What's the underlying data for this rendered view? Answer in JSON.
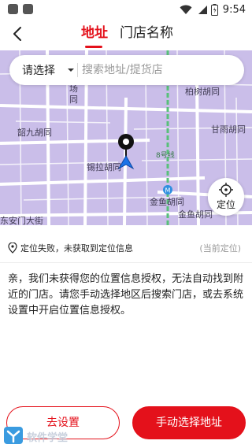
{
  "status_bar": {
    "time": "9:54",
    "battery_icon": "battery-icon",
    "wifi_icon": "wifi-icon"
  },
  "header": {
    "back_icon": "back-arrow-icon",
    "tabs": [
      {
        "label": "地址",
        "active": true
      },
      {
        "label": "门店名称",
        "active": false
      }
    ],
    "accent_color": "#e4111b"
  },
  "search": {
    "region_label": "请选择",
    "placeholder": "搜索地址/提货店"
  },
  "map": {
    "labels": {
      "chang": "场",
      "tong": "同",
      "bai_shu": "柏树胡同",
      "shao_jiu": "韶九胡同",
      "gan_yu": "甘雨胡同",
      "line8": "8号线",
      "xi_la": "锡拉胡同",
      "jin_yu_1": "金鱼胡同",
      "dong_an_men": "东安门大街",
      "jin_yu_2": "金鱼胡同"
    },
    "locate_label": "定位",
    "locate_icon": "crosshair-icon",
    "background_color": "#cabee9"
  },
  "sheet": {
    "location_status": "定位失败，未获取到定位信息",
    "current_location": "(当前定位)",
    "message": "亲，我们未获得您的位置信息授权，无法自动找到附近的门店。请您手动选择地区后搜索门店，或去系统设置中开启位置信息授权。"
  },
  "buttons": {
    "go_settings": "去设置",
    "manual_select": "手动选择地址"
  },
  "watermark": {
    "text": "软件学堂"
  }
}
